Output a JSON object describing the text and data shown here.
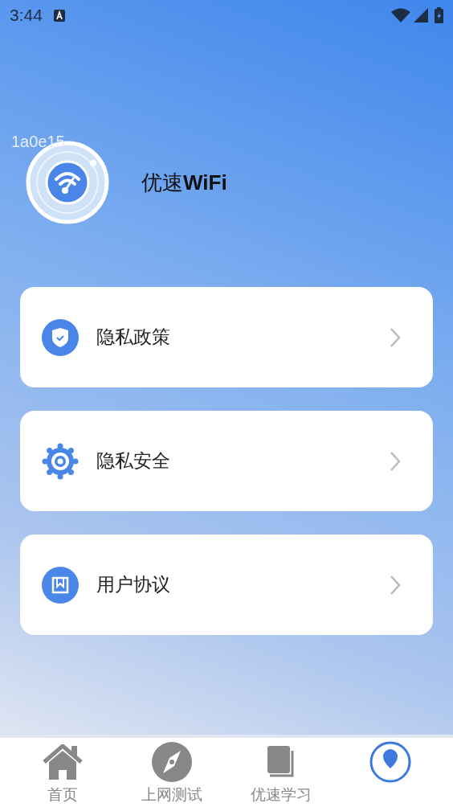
{
  "status_bar": {
    "time": "3:44"
  },
  "overlay_text": "1a0e15",
  "header": {
    "app_name": "优速**WiFi**"
  },
  "menu": [
    {
      "kind": "shield",
      "label": "隐私政策"
    },
    {
      "kind": "gear",
      "label": "隐私安全"
    },
    {
      "kind": "book",
      "label": "用户协议"
    }
  ],
  "tab_bar": [
    {
      "kind": "home",
      "label": "首页",
      "selected": false
    },
    {
      "kind": "compass",
      "label": "上网测试",
      "selected": false
    },
    {
      "kind": "book",
      "label": "优速学习",
      "selected": false
    },
    {
      "kind": "pin",
      "selected": true
    }
  ]
}
